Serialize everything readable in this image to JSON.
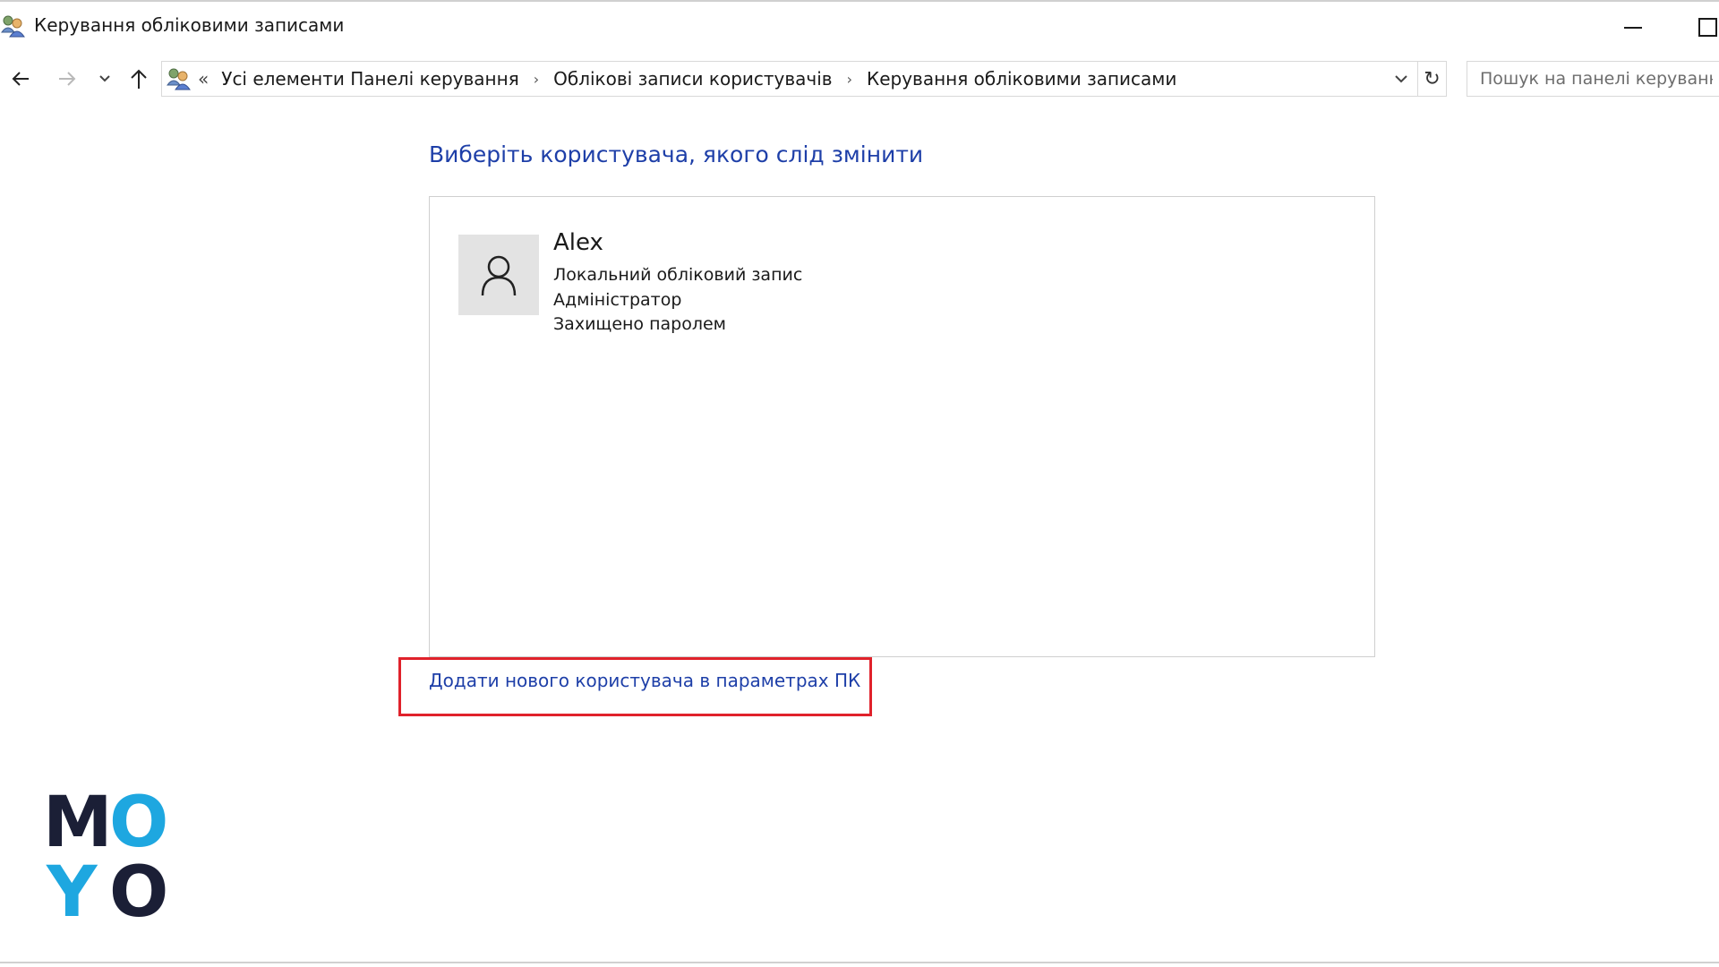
{
  "window": {
    "title": "Керування обліковими записами",
    "icon": "users-icon"
  },
  "navigation": {
    "back_icon": "arrow-left-icon",
    "forward_icon": "arrow-right-icon",
    "recent_icon": "chevron-down-icon",
    "up_icon": "arrow-up-icon",
    "breadcrumb_overflow": "«",
    "breadcrumbs": [
      {
        "label": "Усі елементи Панелі керування"
      },
      {
        "label": "Облікові записи користувачів"
      },
      {
        "label": "Керування обліковими записами"
      }
    ],
    "dropdown_icon": "chevron-down-icon",
    "refresh_icon": "refresh-icon",
    "search_placeholder": "Пошук на панелі керування"
  },
  "content": {
    "heading": "Виберіть користувача, якого слід змінити",
    "users": [
      {
        "name": "Alex",
        "account_type": "Локальний обліковий запис",
        "role": "Адміністратор",
        "protection": "Захищено паролем",
        "avatar_icon": "user-icon"
      }
    ],
    "add_user_link": "Додати нового користувача в параметрах ПК"
  },
  "logo": {
    "letters": [
      "M",
      "O",
      "Y",
      "O"
    ],
    "colors": {
      "dark": "#1b1f36",
      "accent": "#1ea7e0"
    }
  },
  "colors": {
    "link": "#1e3fa8",
    "highlight": "#e0222b"
  }
}
